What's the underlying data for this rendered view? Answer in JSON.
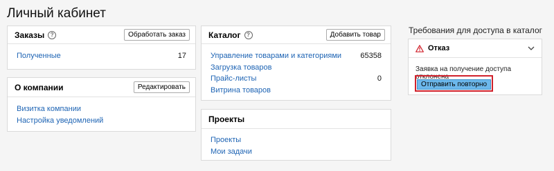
{
  "page": {
    "title": "Личный кабинет"
  },
  "orders": {
    "title": "Заказы",
    "button": "Обработать заказ",
    "rows": [
      {
        "label": "Полученные",
        "count": "17"
      }
    ]
  },
  "company": {
    "title": "О компании",
    "button": "Редактировать",
    "links": [
      "Визитка компании",
      "Настройка уведомлений"
    ]
  },
  "catalog": {
    "title": "Каталог",
    "button": "Добавить товар",
    "rows": [
      {
        "label": "Управление товарами и категориями",
        "count": "65358"
      },
      {
        "label": "Загрузка товаров",
        "count": ""
      },
      {
        "label": "Прайс-листы",
        "count": "0"
      },
      {
        "label": "Витрина товаров",
        "count": ""
      }
    ]
  },
  "projects": {
    "title": "Проекты",
    "links": [
      "Проекты",
      "Мои задачи"
    ]
  },
  "access": {
    "title": "Требования для доступа в каталог",
    "status": "Отказ",
    "message": "Заявка на получение доступа отклонена",
    "button": "Отправить повторно",
    "warn_color": "#d0202a",
    "highlight_color": "#d0202a"
  },
  "icons": {
    "help": "help-icon",
    "warning": "warning-icon",
    "chevron": "chevron-down-icon"
  },
  "colors": {
    "link": "#1e64b4",
    "button_primary": "#6cb8ec",
    "background": "#f5f5f5"
  }
}
